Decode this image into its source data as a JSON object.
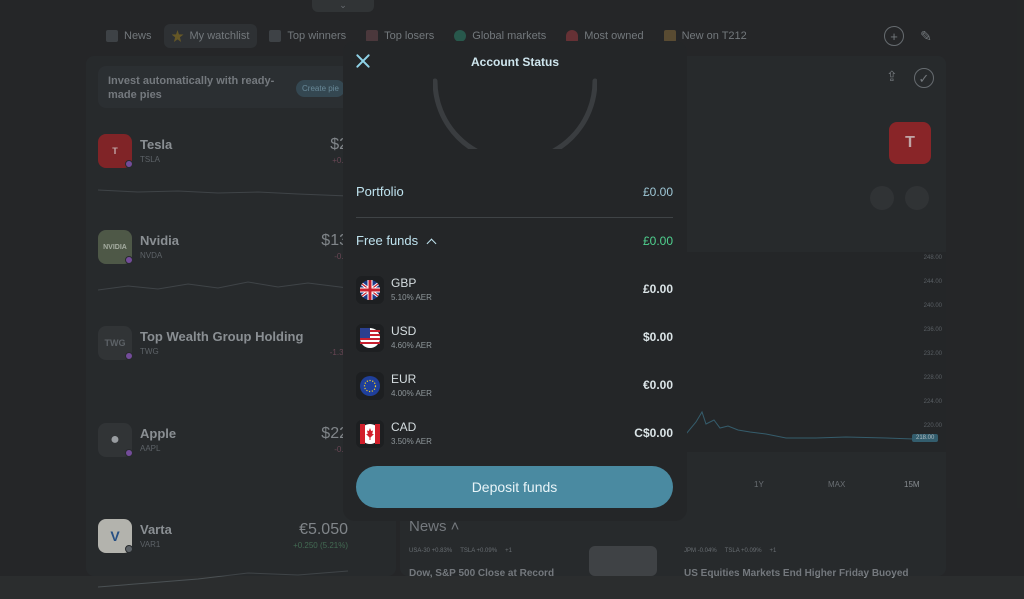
{
  "tabs": [
    {
      "label": "News",
      "icon": "news-icon"
    },
    {
      "label": "My watchlist",
      "icon": "star-icon"
    },
    {
      "label": "Top winners",
      "icon": "trend-up-icon"
    },
    {
      "label": "Top losers",
      "icon": "trend-down-icon"
    },
    {
      "label": "Global markets",
      "icon": "globe-icon"
    },
    {
      "label": "Most owned",
      "icon": "heart-icon"
    },
    {
      "label": "New on T212",
      "icon": "box-icon"
    }
  ],
  "banner": {
    "text": "Invest automatically with ready-made pies",
    "button": "Create pie"
  },
  "stocks": [
    {
      "name": "Tesla",
      "ticker": "TSLA",
      "price": "$2",
      "change": "+0.2",
      "logo": "T"
    },
    {
      "name": "Nvidia",
      "ticker": "NVDA",
      "price": "$13",
      "change": "-0.5",
      "logo": "NVIDIA"
    },
    {
      "name": "Top Wealth Group Holding",
      "ticker": "TWG",
      "price": "",
      "change": "-1.39",
      "logo": "TWG"
    },
    {
      "name": "Apple",
      "ticker": "AAPL",
      "price": "$22",
      "change": "-0.1",
      "logo": ""
    },
    {
      "name": "Varta",
      "ticker": "VAR1",
      "price": "€5.050",
      "change": "+0.250 (5.21%)",
      "logo": "V"
    }
  ],
  "chart_axis": [
    "248.00",
    "244.00",
    "240.00",
    "236.00",
    "232.00",
    "228.00",
    "224.00",
    "220.00"
  ],
  "chart_price": "218.00",
  "periods": [
    "1Y",
    "MAX",
    "15M"
  ],
  "news": {
    "heading": "News",
    "chips_left": [
      "USA-30 +0.83%",
      "TSLA +0.09%",
      "+1"
    ],
    "chips_right": [
      "JPM -0.04%",
      "TSLA +0.09%",
      "+1"
    ],
    "title_left": "Dow, S&P 500 Close at Record",
    "title_right": "US Equities Markets End Higher Friday Buoyed"
  },
  "modal": {
    "title": "Account Status",
    "portfolio_label": "Portfolio",
    "portfolio_value": "£0.00",
    "free_funds_label": "Free funds",
    "free_funds_value": "£0.00",
    "currencies": [
      {
        "code": "GBP",
        "aer": "5.10% AER",
        "amount": "£0.00",
        "flag": "uk-flag-icon"
      },
      {
        "code": "USD",
        "aer": "4.60% AER",
        "amount": "$0.00",
        "flag": "us-flag-icon"
      },
      {
        "code": "EUR",
        "aer": "4.00% AER",
        "amount": "€0.00",
        "flag": "eu-flag-icon"
      },
      {
        "code": "CAD",
        "aer": "3.50% AER",
        "amount": "C$0.00",
        "flag": "canada-flag-icon"
      }
    ],
    "deposit_label": "Deposit funds"
  },
  "colors": {
    "accent": "#4a8aa1",
    "green": "#4fd18f",
    "modal_bg": "#242628"
  }
}
